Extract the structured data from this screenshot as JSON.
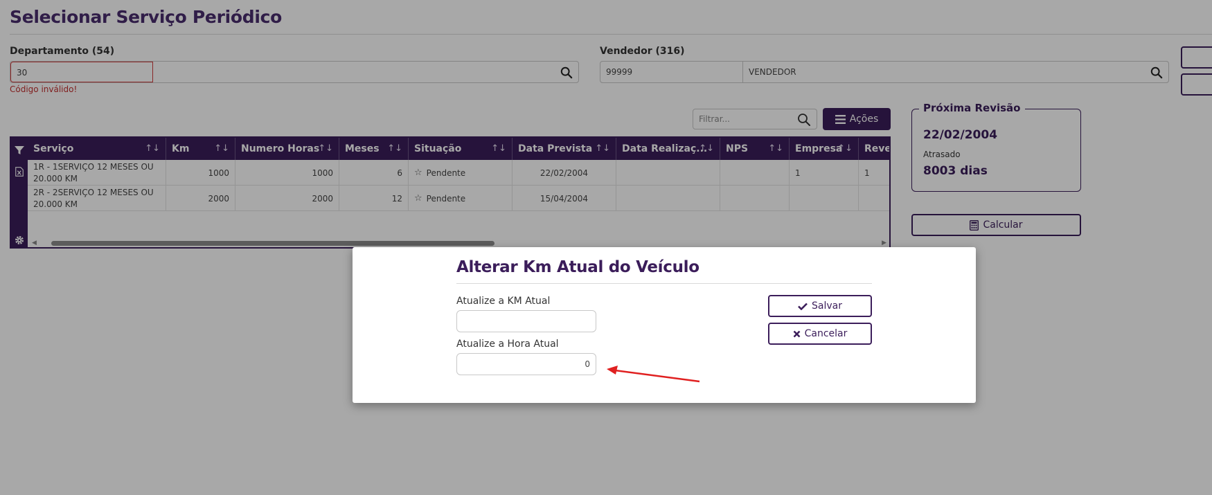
{
  "page": {
    "title": "Selecionar Serviço Periódico"
  },
  "departamento": {
    "label": "Departamento (54)",
    "code": "30",
    "description": "",
    "error": "Código inválido!"
  },
  "vendedor": {
    "label": "Vendedor (316)",
    "code": "99999",
    "description": "VENDEDOR"
  },
  "toolbar": {
    "filter_placeholder": "Filtrar...",
    "acoes_label": "Ações"
  },
  "grid": {
    "columns": [
      "Serviço",
      "Km",
      "Numero Horas",
      "Meses",
      "Situação",
      "Data Prevista",
      "Data Realizaç...",
      "NPS",
      "Empresa",
      "Rever"
    ],
    "sort_glyph": "↑↓",
    "rows": [
      {
        "servico": "1R - 1SERVIÇO 12 MESES OU 20.000 KM",
        "km": "1000",
        "horas": "1000",
        "meses": "6",
        "situacao": "Pendente",
        "data_prevista": "22/02/2004",
        "data_realizacao": "",
        "nps": "",
        "empresa": "1",
        "rever": "1"
      },
      {
        "servico": "2R - 2SERVIÇO 12 MESES OU 20.000 KM",
        "km": "2000",
        "horas": "2000",
        "meses": "12",
        "situacao": "Pendente",
        "data_prevista": "15/04/2004",
        "data_realizacao": "",
        "nps": "",
        "empresa": "",
        "rever": ""
      }
    ]
  },
  "revisao": {
    "title": "Próxima Revisão",
    "date": "22/02/2004",
    "status": "Atrasado",
    "days": "8003 dias"
  },
  "calcular_label": "Calcular",
  "modal": {
    "title": "Alterar Km Atual do Veículo",
    "km_label": "Atualize a KM Atual",
    "km_value": "",
    "hora_label": "Atualize a Hora Atual",
    "hora_value": "0",
    "save_label": "Salvar",
    "cancel_label": "Cancelar"
  },
  "colors": {
    "primary": "#3b1d5a",
    "error": "#c23030",
    "annotation_arrow": "#e02020"
  }
}
